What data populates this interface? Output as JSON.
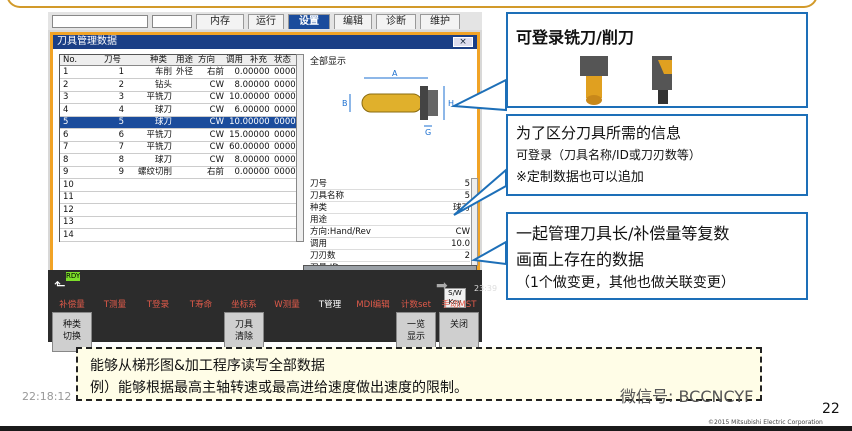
{
  "cnc": {
    "tabs": [
      "内存",
      "运行",
      "设置",
      "编辑",
      "诊断",
      "维护"
    ],
    "active_tab": "设置",
    "window_title": "刀具管理数据",
    "close_label": "×",
    "table": {
      "headers": [
        "No.",
        "刀号",
        "种类",
        "用途",
        "方向",
        "调用",
        "补充",
        "状态"
      ],
      "rows": [
        [
          "1",
          "1",
          "车削",
          "外径",
          "右前",
          "0.0",
          "0000",
          "0000"
        ],
        [
          "2",
          "2",
          "钻头",
          "",
          "CW",
          "8.0",
          "0000",
          "0000"
        ],
        [
          "3",
          "3",
          "平铣刀",
          "",
          "CW",
          "10.0",
          "0000",
          "0000"
        ],
        [
          "4",
          "4",
          "球刀",
          "",
          "CW",
          "6.0",
          "0000",
          "0000"
        ],
        [
          "5",
          "5",
          "球刀",
          "",
          "CW",
          "10.0",
          "0000",
          "0000"
        ],
        [
          "6",
          "6",
          "平铣刀",
          "",
          "CW",
          "15.0",
          "0000",
          "0000"
        ],
        [
          "7",
          "7",
          "平铣刀",
          "",
          "CW",
          "60.0",
          "0000",
          "0000"
        ],
        [
          "8",
          "8",
          "球刀",
          "",
          "CW",
          "8.0",
          "0000",
          "0000"
        ],
        [
          "9",
          "9",
          "螺纹切削",
          "",
          "右前",
          "0.0",
          "0000",
          "0000"
        ],
        [
          "10",
          "",
          "",
          "",
          "",
          "",
          "",
          ""
        ],
        [
          "11",
          "",
          "",
          "",
          "",
          "",
          "",
          ""
        ],
        [
          "12",
          "",
          "",
          "",
          "",
          "",
          "",
          ""
        ],
        [
          "13",
          "",
          "",
          "",
          "",
          "",
          "",
          ""
        ],
        [
          "14",
          "",
          "",
          "",
          "",
          "",
          "",
          ""
        ]
      ],
      "selected_index": 4
    },
    "right_panel": {
      "header": "全部显示",
      "diagram_labels": [
        "A",
        "B",
        "H",
        "G"
      ],
      "props": [
        {
          "k": "刀号",
          "v": "5"
        },
        {
          "k": "刀具名称",
          "v": "5"
        },
        {
          "k": "种类",
          "v": "球刀"
        },
        {
          "k": "用途",
          "v": ""
        },
        {
          "k": "方向:Hand/Rev",
          "v": "CW"
        },
        {
          "k": "调用",
          "v": "10.0"
        },
        {
          "k": "刀刃数",
          "v": "2"
        },
        {
          "k": "刀具 ID",
          "v": ""
        }
      ]
    },
    "status": {
      "rdy": "RDY",
      "clock": "23:39",
      "sw_key": "S/W Key"
    },
    "softkeys_top": [
      "补偿量",
      "T测量",
      "T登录",
      "T寿命",
      "坐标系",
      "W测量",
      "T管理",
      "MDI编辑",
      "计数set",
      "手动MST"
    ],
    "softkeys_bottom": [
      {
        "label": "种类\n切换",
        "slot": 0
      },
      {
        "label": "刀具\n清除",
        "slot": 4
      },
      {
        "label": "一览\n显示",
        "slot": 8
      },
      {
        "label": "关闭",
        "slot": 9
      }
    ]
  },
  "callouts": {
    "c1_title": "可登录铣刀/削刀",
    "c2_line1": "为了区分刀具所需的信息",
    "c2_line2": "可登录（刀具名称/ID或刀刃数等）",
    "c2_line3": "※定制数据也可以追加",
    "c3_line1": "一起管理刀具长/补偿量等复数",
    "c3_line2": "画面上存在的数据",
    "c3_line3": "（1个做变更，其他也做关联变更）"
  },
  "note": {
    "line1": "能够从梯形图&加工程序读写全部数据",
    "line2": "例）能够根据最高主轴转速或最高进给速度做出速度的限制。"
  },
  "footer": {
    "time": "22:18:12",
    "wechat": "微信号: BCCNCYF",
    "page": "22",
    "copyright": "©2015 Mitsubishi Electric Corporation"
  }
}
